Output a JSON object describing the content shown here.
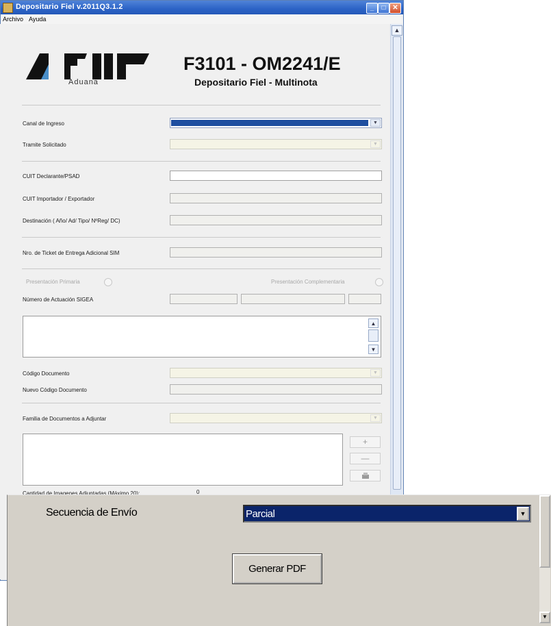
{
  "window": {
    "title": "Depositario Fiel v.2011Q3.1.2",
    "buttons": {
      "minimize": "_",
      "maximize": "□",
      "close": "✕"
    }
  },
  "menu": {
    "items": [
      "Archivo",
      "Ayuda"
    ]
  },
  "header": {
    "logo_sub": "Aduana",
    "title": "F3101 - OM2241/E",
    "subtitle": "Depositario Fiel - Multinota"
  },
  "form": {
    "canal_label": "Canal de Ingreso",
    "tramite_label": "Tramite Solicitado",
    "cuit_declarante_label": "CUIT Declarante/PSAD",
    "cuit_importador_label": "CUIT Importador / Exportador",
    "destinacion_label": "Destinación ( Año/  Ad/ Tipo/ NºReg/ DC)",
    "ticket_label": "Nro. de Ticket de Entrega Adicional SIM",
    "presentacion_primaria": "Presentación Primaria",
    "presentacion_complementaria": "Presentación Complementaria",
    "numero_actuacion_label": "Número de Actuación SIGEA",
    "codigo_documento_label": "Código Documento",
    "nuevo_codigo_label": "Nuevo Código Documento",
    "familia_label": "Familia de Documentos a Adjuntar",
    "cantidad_label": "Cantidad de Imagenes Adjuntadas (Máximo 20):",
    "cantidad_value": "0",
    "add_symbol": "+",
    "remove_symbol": "—"
  },
  "overlay": {
    "secuencia_label": "Secuencia de Envío",
    "secuencia_value": "Parcial",
    "generar_button": "Generar PDF"
  },
  "colors": {
    "titlebar": "#2c63c6",
    "selection": "#0a246a",
    "panel": "#f0f0f0",
    "classic_panel": "#d4d0c8"
  }
}
